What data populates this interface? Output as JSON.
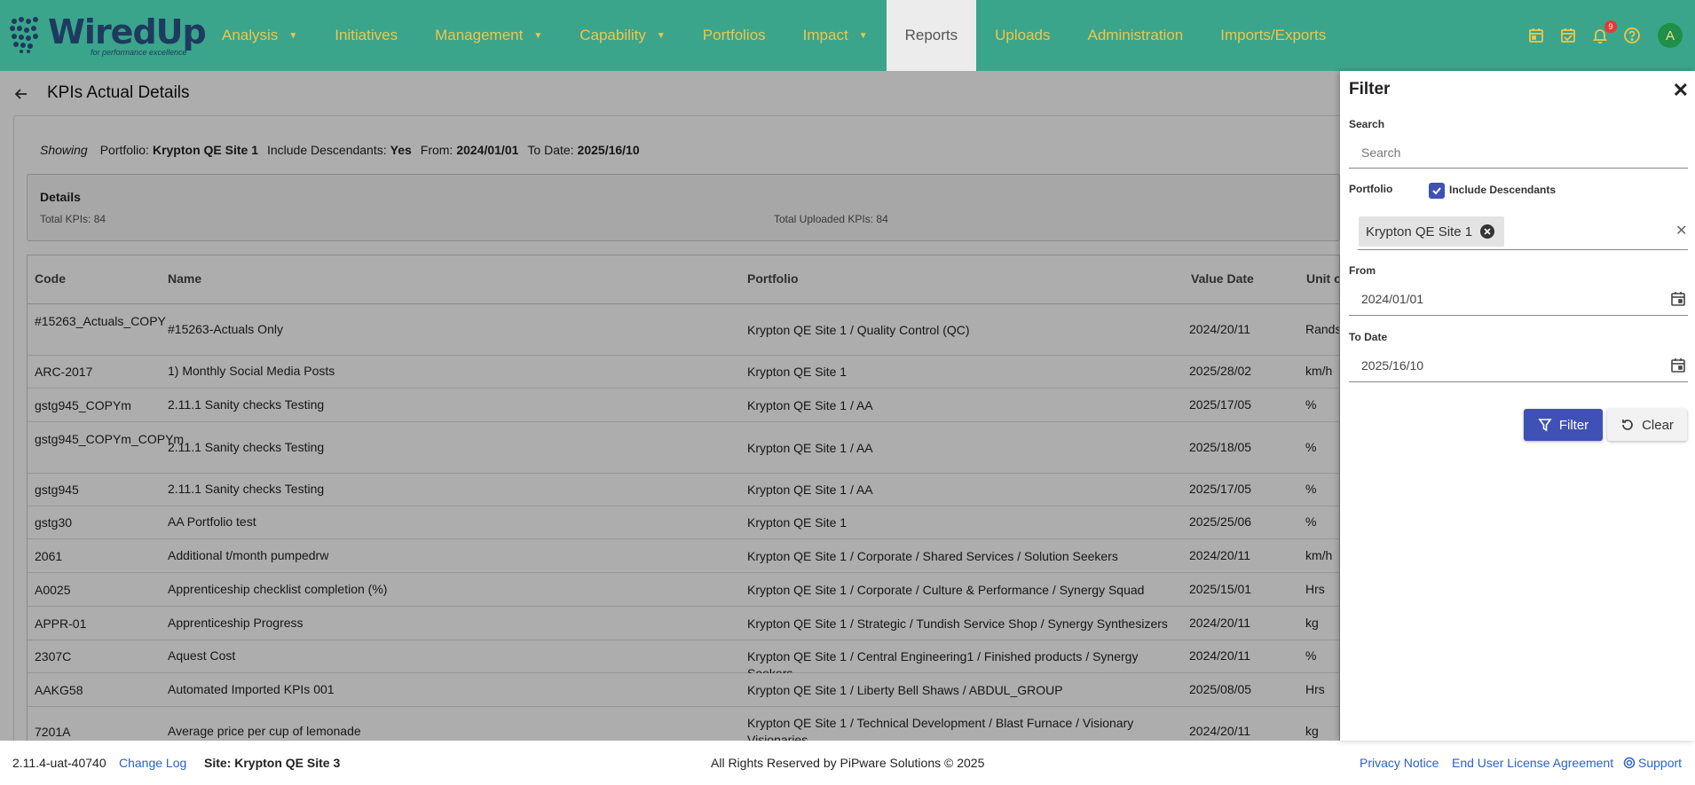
{
  "app": {
    "logo_text": "WiredUp",
    "logo_tagline": "for performance excellence"
  },
  "nav": [
    {
      "label": "Analysis",
      "caret": true
    },
    {
      "label": "Initiatives",
      "caret": false
    },
    {
      "label": "Management",
      "caret": true
    },
    {
      "label": "Capability",
      "caret": true
    },
    {
      "label": "Portfolios",
      "caret": false
    },
    {
      "label": "Impact",
      "caret": true
    },
    {
      "label": "Reports",
      "caret": false,
      "active": true
    },
    {
      "label": "Uploads",
      "caret": false
    },
    {
      "label": "Administration",
      "caret": false
    },
    {
      "label": "Imports/Exports",
      "caret": false
    }
  ],
  "top_icons": {
    "calendar_icon": "calendar-icon",
    "tasks_icon": "calendar-check-icon",
    "notifications_icon": "bell-icon",
    "notifications_count": "9",
    "help_icon": "help-icon",
    "avatar_initial": "A"
  },
  "page": {
    "title": "KPIs Actual Details"
  },
  "showing": {
    "prefix": "Showing",
    "portfolio_label": "Portfolio:",
    "portfolio_value": "Krypton QE Site 1",
    "descendants_label": "Include Descendants:",
    "descendants_value": "Yes",
    "from_label": "From:",
    "from_value": "2024/01/01",
    "to_label": "To Date:",
    "to_value": "2025/16/10"
  },
  "details": {
    "title": "Details",
    "total_kpis": "Total KPIs: 84",
    "total_uploaded": "Total Uploaded KPIs: 84"
  },
  "table": {
    "columns": [
      "Code",
      "Name",
      "Portfolio",
      "Value Date",
      "Unit of"
    ],
    "rows": [
      {
        "code": "#15263_Actuals_COPY",
        "name": "#15263-Actuals Only",
        "portfolio": "Krypton QE Site 1 / Quality Control (QC)",
        "date": "2024/20/11",
        "unit": "Rands"
      },
      {
        "code": "ARC-2017",
        "name": "1) Monthly Social Media Posts",
        "portfolio": "Krypton QE Site 1",
        "date": "2025/28/02",
        "unit": "km/h"
      },
      {
        "code": "gstg945_COPYm",
        "name": "2.11.1 Sanity checks Testing",
        "portfolio": "Krypton QE Site 1 / AA",
        "date": "2025/17/05",
        "unit": "%"
      },
      {
        "code": "gstg945_COPYm_COPYm",
        "name": "2.11.1 Sanity checks Testing",
        "portfolio": "Krypton QE Site 1 / AA",
        "date": "2025/18/05",
        "unit": "%"
      },
      {
        "code": "gstg945",
        "name": "2.11.1 Sanity checks Testing",
        "portfolio": "Krypton QE Site 1 / AA",
        "date": "2025/17/05",
        "unit": "%"
      },
      {
        "code": "gstg30",
        "name": "AA Portfolio test",
        "portfolio": "Krypton QE Site 1",
        "date": "2025/25/06",
        "unit": "%"
      },
      {
        "code": "2061",
        "name": "Additional t/month pumpedrw",
        "portfolio": "Krypton QE Site 1 / Corporate / Shared Services / Solution Seekers",
        "date": "2024/20/11",
        "unit": "km/h"
      },
      {
        "code": "A0025",
        "name": "Apprenticeship checklist completion (%)",
        "portfolio": "Krypton QE Site 1 / Corporate / Culture & Performance / Synergy Squad",
        "date": "2025/15/01",
        "unit": "Hrs"
      },
      {
        "code": "APPR-01",
        "name": "Apprenticeship Progress",
        "portfolio": "Krypton QE Site 1 / Strategic / Tundish Service Shop / Synergy Synthesizers",
        "date": "2024/20/11",
        "unit": "kg"
      },
      {
        "code": "2307C",
        "name": "Aquest Cost",
        "portfolio": "Krypton QE Site 1 / Central Engineering1 / Finished products / Synergy Seekers",
        "date": "2024/20/11",
        "unit": "%"
      },
      {
        "code": "AAKG58",
        "name": "Automated Imported KPIs 001",
        "portfolio": "Krypton QE Site 1 / Liberty Bell Shaws / ABDUL_GROUP",
        "date": "2025/08/05",
        "unit": "Hrs"
      },
      {
        "code": "7201A",
        "name": "Average price per cup of lemonade",
        "portfolio": "Krypton QE Site 1 / Technical Development / Blast Furnace / Visionary Visionaries",
        "date": "2024/20/11",
        "unit": "kg"
      }
    ]
  },
  "footer": {
    "version": "2.11.4-uat-40740",
    "changelog": "Change Log",
    "site": "Site: Krypton QE Site 3",
    "copyright": "All Rights Reserved by PiPware Solutions © 2025",
    "privacy": "Privacy Notice",
    "eula": "End User License Agreement",
    "support": "Support"
  },
  "filter": {
    "title": "Filter",
    "search_label": "Search",
    "search_placeholder": "Search",
    "portfolio_label": "Portfolio",
    "include_descendants": "Include Descendants",
    "include_descendants_checked": true,
    "portfolio_chip": "Krypton QE Site 1",
    "from_label": "From",
    "from_value": "2024/01/01",
    "to_label": "To Date",
    "to_value": "2025/16/10",
    "filter_button": "Filter",
    "clear_button": "Clear"
  },
  "colors": {
    "nav_bg": "#3aa58b",
    "nav_text": "#f0c64a",
    "primary": "#3f51b5",
    "link": "#2b62c9"
  }
}
